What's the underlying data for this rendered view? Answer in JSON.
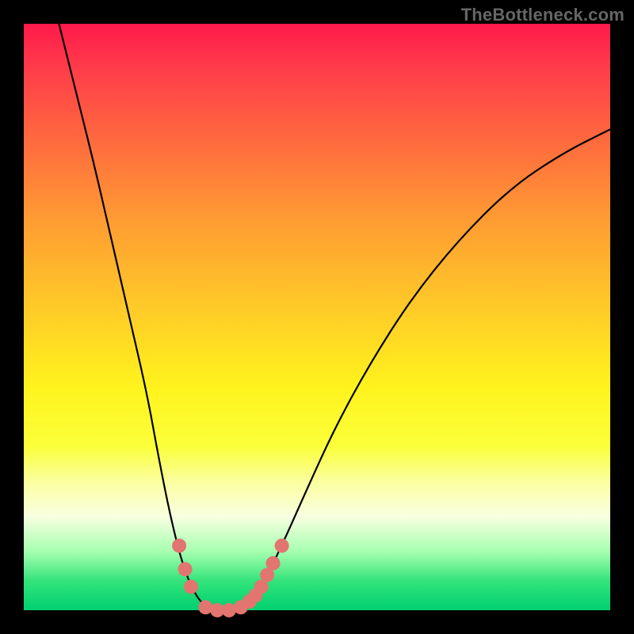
{
  "watermark": "TheBottleneck.com",
  "colors": {
    "frame": "#000000",
    "gradient_top": "#ff1a4b",
    "gradient_bottom": "#00d070",
    "curve_stroke": "#000000",
    "marker_fill": "#e2756f"
  },
  "chart_data": {
    "type": "line",
    "title": "",
    "xlabel": "",
    "ylabel": "",
    "xlim": [
      0,
      100
    ],
    "ylim": [
      0,
      100
    ],
    "grid": false,
    "legend": false,
    "curve": [
      {
        "x": 6,
        "y": 100
      },
      {
        "x": 9,
        "y": 88
      },
      {
        "x": 12,
        "y": 76
      },
      {
        "x": 15,
        "y": 63
      },
      {
        "x": 18,
        "y": 50
      },
      {
        "x": 21,
        "y": 37
      },
      {
        "x": 23,
        "y": 26
      },
      {
        "x": 25,
        "y": 16
      },
      {
        "x": 27,
        "y": 8
      },
      {
        "x": 29,
        "y": 3
      },
      {
        "x": 31,
        "y": 0.5
      },
      {
        "x": 33,
        "y": 0
      },
      {
        "x": 35,
        "y": 0
      },
      {
        "x": 37,
        "y": 0.5
      },
      {
        "x": 39,
        "y": 2
      },
      {
        "x": 41,
        "y": 5
      },
      {
        "x": 44,
        "y": 11
      },
      {
        "x": 48,
        "y": 20
      },
      {
        "x": 53,
        "y": 31
      },
      {
        "x": 59,
        "y": 42
      },
      {
        "x": 66,
        "y": 53
      },
      {
        "x": 74,
        "y": 63
      },
      {
        "x": 83,
        "y": 72
      },
      {
        "x": 92,
        "y": 78
      },
      {
        "x": 100,
        "y": 82
      }
    ],
    "markers": [
      {
        "x": 26.5,
        "y": 11
      },
      {
        "x": 27.5,
        "y": 7
      },
      {
        "x": 28.5,
        "y": 4
      },
      {
        "x": 31,
        "y": 0.5
      },
      {
        "x": 33,
        "y": 0
      },
      {
        "x": 35,
        "y": 0
      },
      {
        "x": 37,
        "y": 0.5
      },
      {
        "x": 38.5,
        "y": 1.5
      },
      {
        "x": 39.5,
        "y": 2.5
      },
      {
        "x": 40.5,
        "y": 4
      },
      {
        "x": 41.5,
        "y": 6
      },
      {
        "x": 42.5,
        "y": 8
      },
      {
        "x": 44,
        "y": 11
      }
    ]
  }
}
